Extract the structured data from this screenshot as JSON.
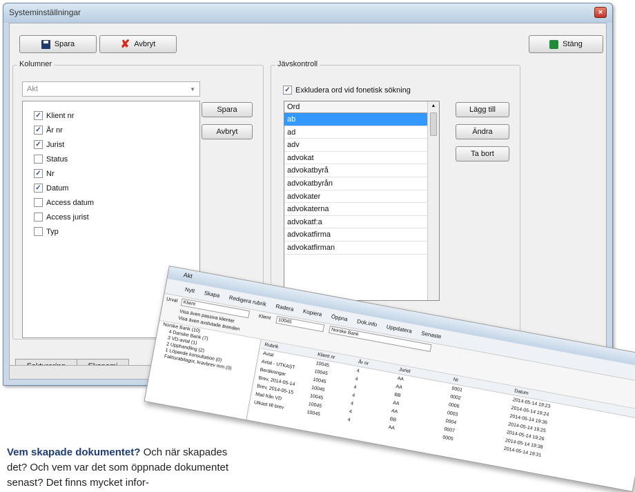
{
  "window": {
    "title": "Systeminställningar",
    "close_glyph": "×"
  },
  "toolbar": {
    "save_label": "Spara",
    "cancel_label": "Avbryt",
    "close_label": "Stäng"
  },
  "columns": {
    "group_label": "Kolumner",
    "combo_value": "Akt",
    "items": [
      {
        "label": "Klient nr",
        "checked": true
      },
      {
        "label": "År nr",
        "checked": true
      },
      {
        "label": "Jurist",
        "checked": true
      },
      {
        "label": "Status",
        "checked": false
      },
      {
        "label": "Nr",
        "checked": true
      },
      {
        "label": "Datum",
        "checked": true
      },
      {
        "label": "Access datum",
        "checked": false
      },
      {
        "label": "Access jurist",
        "checked": false
      },
      {
        "label": "Typ",
        "checked": false
      }
    ],
    "save_label": "Spara",
    "cancel_label": "Avbryt"
  },
  "jav": {
    "group_label": "Jävskontroll",
    "exclude_label": "Exkludera ord vid fonetisk sökning",
    "exclude_checked": true,
    "list_header": "Ord",
    "words": [
      "ab",
      "ad",
      "adv",
      "advokat",
      "advokatbyrå",
      "advokatbyrån",
      "advokater",
      "advokaterna",
      "advokatf:a",
      "advokatfirma",
      "advokatfirman"
    ],
    "selected_word": "ab",
    "add_label": "Lägg till",
    "edit_label": "Ändra",
    "delete_label": "Ta bort"
  },
  "tabs": [
    "Fakturering",
    "Ekonomi"
  ],
  "overlay": {
    "title": "Akt",
    "ribbon": [
      "Nytt",
      "Skapa",
      "Redigera rubrik",
      "Radera",
      "Kopiera",
      "Öppna",
      "Dok.info",
      "Uppdatera",
      "Senaste"
    ],
    "filter": {
      "urval_label": "Urval",
      "urval_value": "Klient",
      "klient_label": "Klient",
      "klient_value": "10045",
      "klient_name": "Norske Bank",
      "show_passive": "Visa även passiva klienter",
      "show_closed": "Visa även avslutade ärenden"
    },
    "tree": [
      "Norske Bank (10)",
      "4 Danske Bank (7)",
      "3 VD-avtal (1)",
      "2 Upphandling (2)",
      "1 Löpande konsultation (0)",
      "Fakturabilagor, kravbrev mm (0)"
    ],
    "table": {
      "headers": [
        "Rubrik",
        "Klient nr",
        "År nr",
        "Jurist",
        "Nr",
        "Datum"
      ],
      "rows": [
        [
          "Avtal",
          "10045",
          "4",
          "AA",
          "0001",
          "2014-05-14 19:23"
        ],
        [
          "Avtal - UTKAST",
          "10045",
          "4",
          "AA",
          "0002",
          "2014-05-14 19:24"
        ],
        [
          "Beräkningar",
          "10045",
          "4",
          "BB",
          "0006",
          "2014-05-14 19:36"
        ],
        [
          "Brev, 2014-05-14",
          "10045",
          "4",
          "AA",
          "0003",
          "2014-05-14 19:25"
        ],
        [
          "Brev, 2014-05-15",
          "10045",
          "4",
          "AA",
          "0004",
          "2014-05-14 19:26"
        ],
        [
          "Mail från VD",
          "10045",
          "4",
          "BB",
          "0007",
          "2014-05-14 19:38"
        ],
        [
          "Utkast till brev",
          "10045",
          "4",
          "AA",
          "0005",
          "2014-05-14 19:31"
        ]
      ]
    }
  },
  "caption": {
    "bold": "Vem skapade dokumentet?",
    "text": " Och när skapades det? Och vem var det som öppnade dokumentet senast? Det finns mycket infor-"
  }
}
